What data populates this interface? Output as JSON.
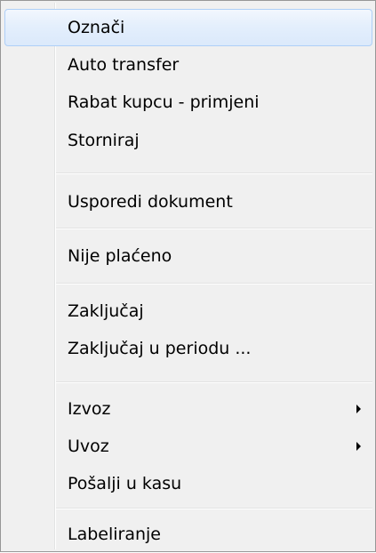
{
  "menu": {
    "items": [
      {
        "label": "Označi",
        "highlighted": true
      },
      {
        "label": "Auto transfer"
      },
      {
        "label": "Rabat kupcu - primjeni"
      },
      {
        "label": "Storniraj"
      },
      {
        "label": "Usporedi dokument"
      },
      {
        "label": "Nije plaćeno"
      },
      {
        "label": "Zaključaj"
      },
      {
        "label": "Zaključaj u periodu ..."
      },
      {
        "label": "Izvoz",
        "submenu": true,
        "icon": "chevron-right-icon"
      },
      {
        "label": "Uvoz",
        "submenu": true,
        "icon": "chevron-right-icon"
      },
      {
        "label": "Pošalji u kasu"
      },
      {
        "label": "Labeliranje"
      }
    ]
  },
  "colors": {
    "menu_background": "#f0f0f0",
    "menu_border": "#979797",
    "highlight_border": "#aecff7",
    "highlight_fill": "#dbe9fb",
    "separator": "#e2e3e3"
  }
}
